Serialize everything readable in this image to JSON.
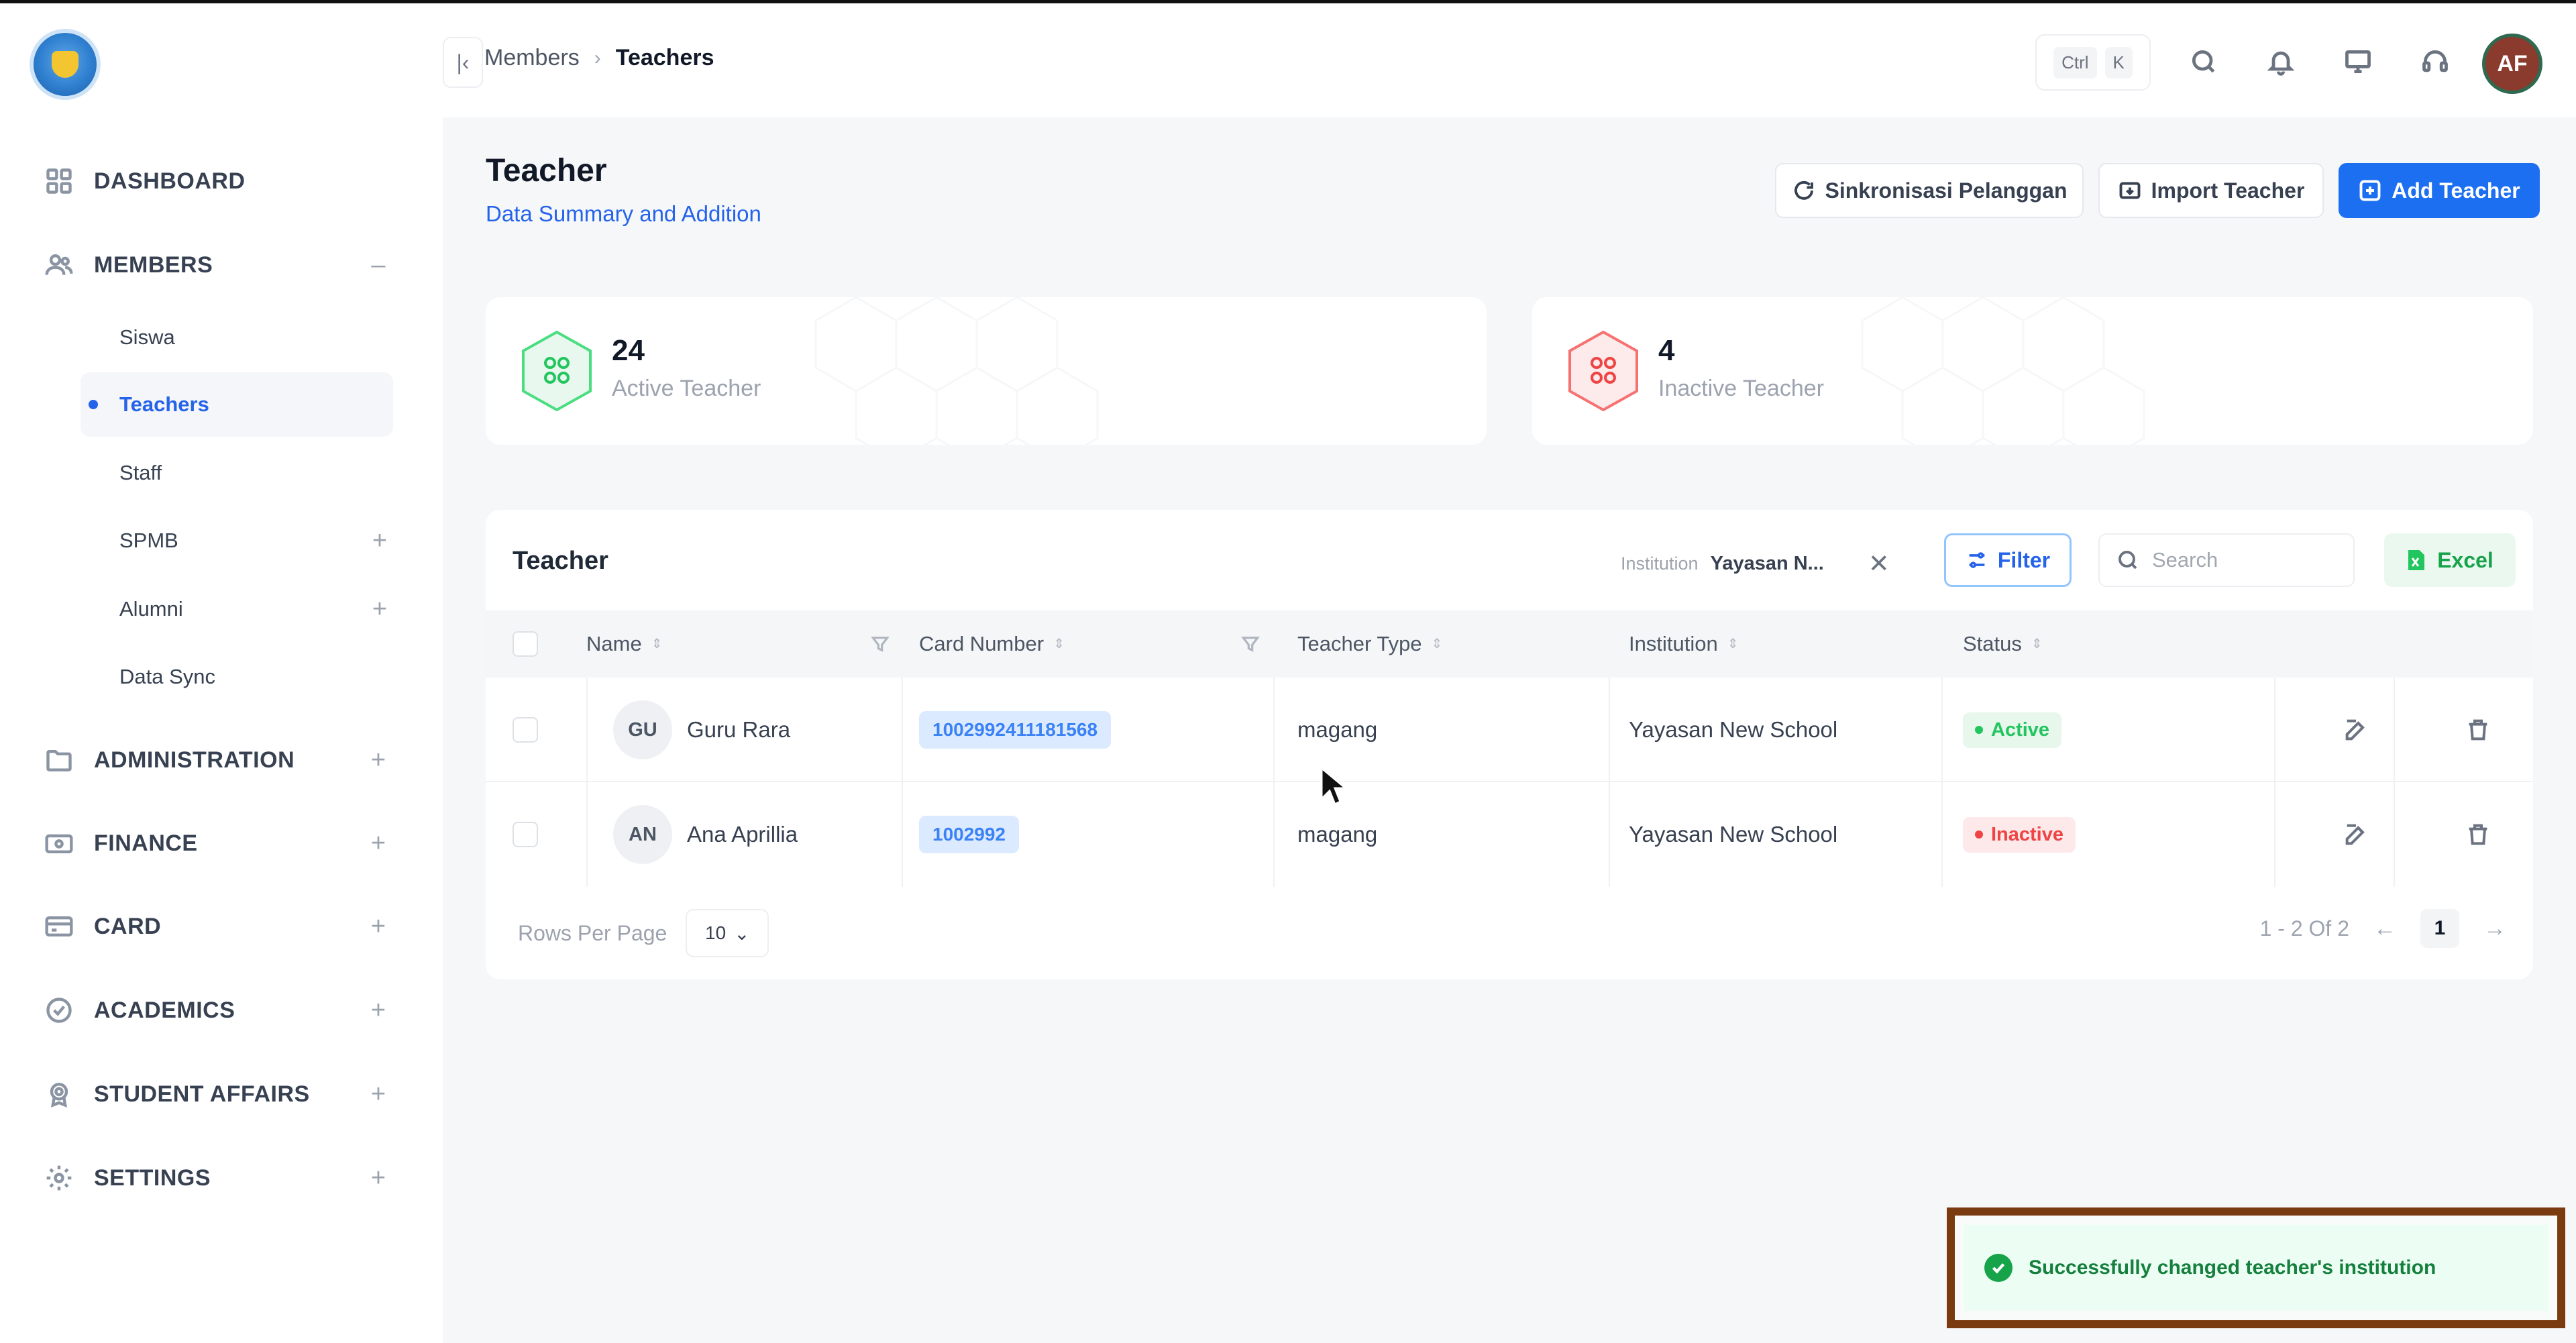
{
  "sidebar": {
    "nav": [
      {
        "label": "DASHBOARD",
        "toggle": ""
      },
      {
        "label": "MEMBERS",
        "toggle": "–"
      },
      {
        "label": "ADMINISTRATION",
        "toggle": "+"
      },
      {
        "label": "FINANCE",
        "toggle": "+"
      },
      {
        "label": "CARD",
        "toggle": "+"
      },
      {
        "label": "ACADEMICS",
        "toggle": "+"
      },
      {
        "label": "STUDENT AFFAIRS",
        "toggle": "+"
      },
      {
        "label": "SETTINGS",
        "toggle": "+"
      }
    ],
    "members_sub": [
      {
        "label": "Siswa",
        "toggle": ""
      },
      {
        "label": "Teachers",
        "toggle": ""
      },
      {
        "label": "Staff",
        "toggle": ""
      },
      {
        "label": "SPMB",
        "toggle": "+"
      },
      {
        "label": "Alumni",
        "toggle": "+"
      },
      {
        "label": "Data Sync",
        "toggle": ""
      }
    ]
  },
  "topbar": {
    "breadcrumb": [
      "Members",
      "Teachers"
    ],
    "shortcut": [
      "Ctrl",
      "K"
    ],
    "avatar_initials": "AF"
  },
  "page": {
    "title": "Teacher",
    "subtitle": "Data Summary and Addition",
    "buttons": {
      "sync": "Sinkronisasi Pelanggan",
      "import": "Import Teacher",
      "add": "Add Teacher"
    }
  },
  "stats": [
    {
      "value": "24",
      "label": "Active Teacher",
      "color": "#22c55e"
    },
    {
      "value": "4",
      "label": "Inactive Teacher",
      "color": "#ef4444"
    }
  ],
  "table": {
    "title": "Teacher",
    "filter": {
      "key": "Institution",
      "value": "Yayasan N...",
      "clear": "✕"
    },
    "filter_button": "Filter",
    "search_placeholder": "Search",
    "excel_button": "Excel",
    "columns": [
      "Name",
      "Card Number",
      "Teacher Type",
      "Institution",
      "Status"
    ],
    "rows": [
      {
        "initials": "GU",
        "name": "Guru Rara",
        "card": "1002992411181568",
        "type": "magang",
        "institution": "Yayasan New School",
        "status": "Active"
      },
      {
        "initials": "AN",
        "name": "Ana Aprillia",
        "card": "1002992",
        "type": "magang",
        "institution": "Yayasan New School",
        "status": "Inactive"
      }
    ],
    "rows_per_page_label": "Rows Per Page",
    "rows_per_page": "10",
    "page_info": "1 - 2 Of 2",
    "current_page": "1"
  },
  "toast": {
    "message": "Successfully changed teacher's institution"
  }
}
